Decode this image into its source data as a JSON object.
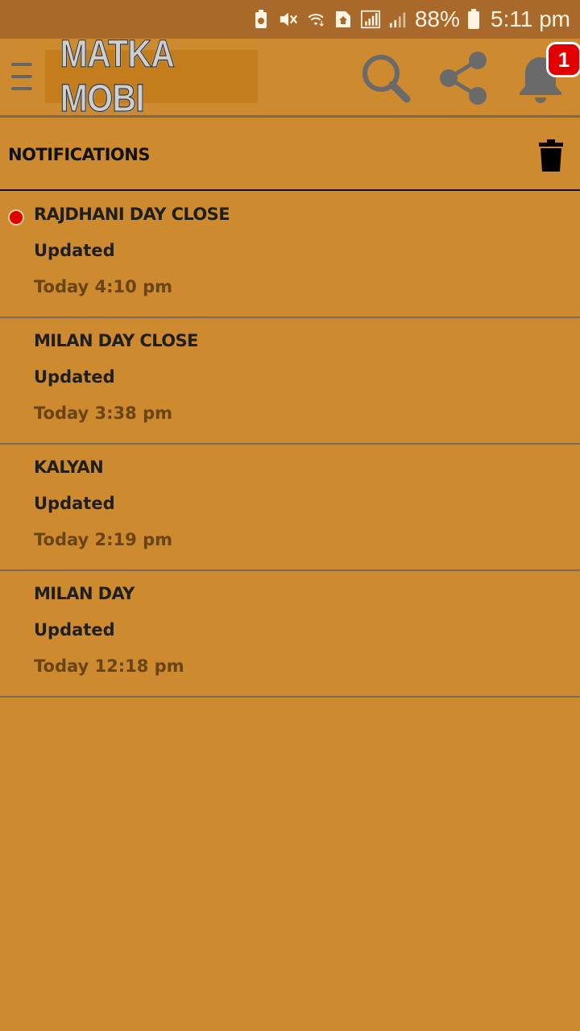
{
  "status_bar": {
    "battery_percent": "88%",
    "time": "5:11 pm",
    "icons": [
      "battery-saver-icon",
      "mute-icon",
      "wifi-icon",
      "home-sim-icon",
      "signal-icon",
      "signal-weak-icon",
      "battery-icon"
    ]
  },
  "app_bar": {
    "logo_text": "MATKA MOBI",
    "notification_count": "1",
    "icons": [
      "menu-icon",
      "search-icon",
      "share-icon",
      "bell-icon"
    ]
  },
  "section": {
    "title": "NOTIFICATIONS",
    "action_icon": "trash-icon"
  },
  "notifications": [
    {
      "title": "RAJDHANI DAY CLOSE",
      "status": "Updated",
      "time": "Today 4:10 pm",
      "unread": true
    },
    {
      "title": "MILAN DAY CLOSE",
      "status": "Updated",
      "time": "Today 3:38 pm",
      "unread": false
    },
    {
      "title": "KALYAN",
      "status": "Updated",
      "time": "Today 2:19 pm",
      "unread": false
    },
    {
      "title": "MILAN DAY",
      "status": "Updated",
      "time": "Today 12:18 pm",
      "unread": false
    }
  ],
  "colors": {
    "background": "#cd8a2e",
    "status_bar": "#a8692a",
    "unread_dot": "#e00000",
    "badge": "#e30000",
    "time_text": "#6a4416"
  }
}
